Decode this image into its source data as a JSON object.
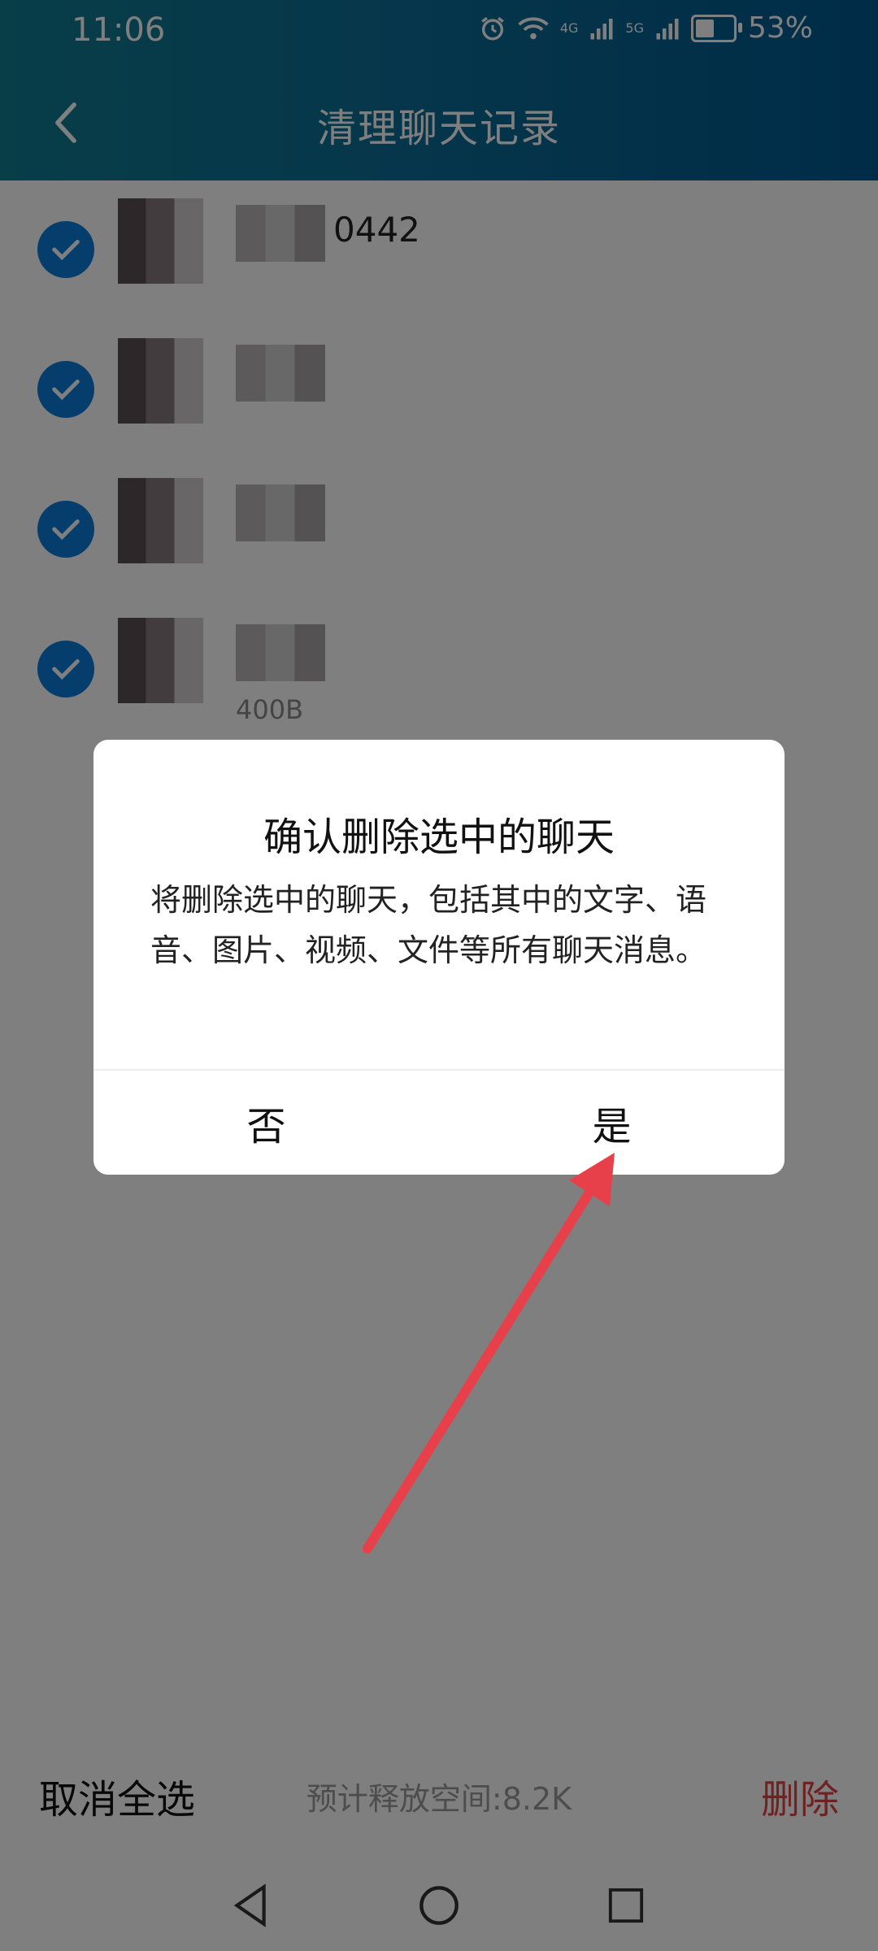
{
  "status_bar": {
    "time": "11:06",
    "network_1": "4G",
    "network_2": "5G",
    "battery": "53%"
  },
  "header": {
    "title": "清理聊天记录"
  },
  "chat_list": {
    "items": [
      {
        "name_visible": "0442",
        "size": "",
        "checked": true
      },
      {
        "name_visible": "",
        "size": "",
        "checked": true
      },
      {
        "name_visible": "",
        "size": "",
        "checked": true
      },
      {
        "name_visible": "",
        "size": "400B",
        "checked": true
      }
    ]
  },
  "bottom_bar": {
    "deselect_all": "取消全选",
    "release_space": "预计释放空间:8.2K",
    "delete": "删除"
  },
  "dialog": {
    "title": "确认删除选中的聊天",
    "message": "将删除选中的聊天，包括其中的文字、语音、图片、视频、文件等所有聊天消息。",
    "no": "否",
    "yes": "是"
  },
  "colors": {
    "header_gradient_start": "#0f7c8f",
    "header_gradient_end": "#00588e",
    "check_blue": "#0a7cd8",
    "delete_red": "#e04545",
    "arrow_red": "#e8404a"
  }
}
